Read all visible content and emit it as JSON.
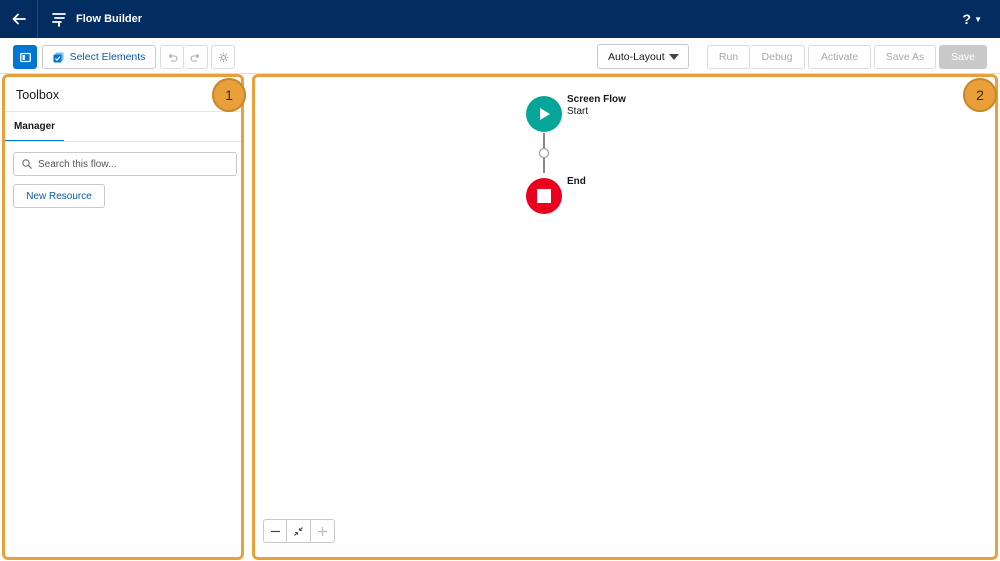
{
  "header": {
    "title": "Flow Builder",
    "help_label": "?"
  },
  "toolbar": {
    "select_elements_label": "Select Elements",
    "layout_value": "Auto-Layout",
    "run_label": "Run",
    "debug_label": "Debug",
    "activate_label": "Activate",
    "save_as_label": "Save As",
    "save_label": "Save"
  },
  "toolbox": {
    "title": "Toolbox",
    "tab_label": "Manager",
    "search_placeholder": "Search this flow...",
    "new_resource_label": "New Resource",
    "badge": "1"
  },
  "canvas": {
    "badge": "2",
    "start_node": {
      "title": "Screen Flow",
      "subtitle": "Start"
    },
    "end_node": {
      "title": "End"
    }
  },
  "colors": {
    "header_bg": "#032d60",
    "accent": "#0176d3",
    "highlight_border": "#e8a13a",
    "start_node": "#06a59a",
    "end_node": "#ea001e"
  }
}
